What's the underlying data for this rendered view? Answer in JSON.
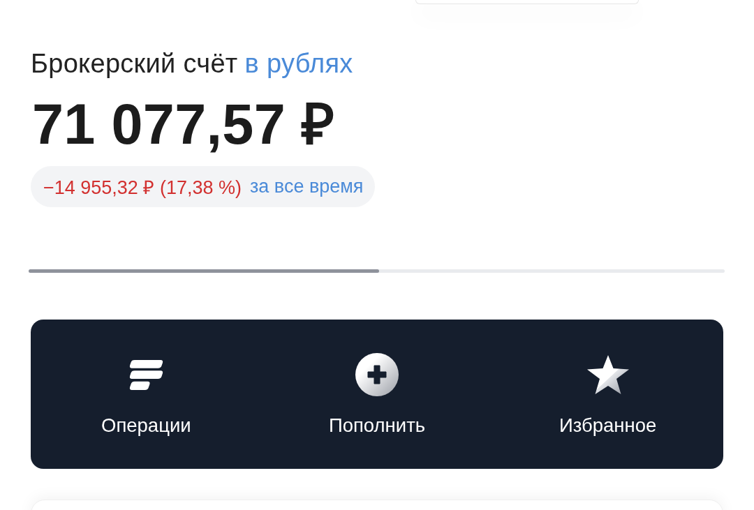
{
  "account": {
    "title": "Брокерский счёт",
    "currency_link": "в рублях"
  },
  "balance": "71 077,57 ₽",
  "change": {
    "amount": "−14 955,32 ₽ (17,38 %)",
    "period": "за все время",
    "negative": true
  },
  "actions": [
    {
      "kind": "operations",
      "label": "Операции"
    },
    {
      "kind": "top_up",
      "label": "Пополнить"
    },
    {
      "kind": "favorites",
      "label": "Избранное"
    }
  ]
}
